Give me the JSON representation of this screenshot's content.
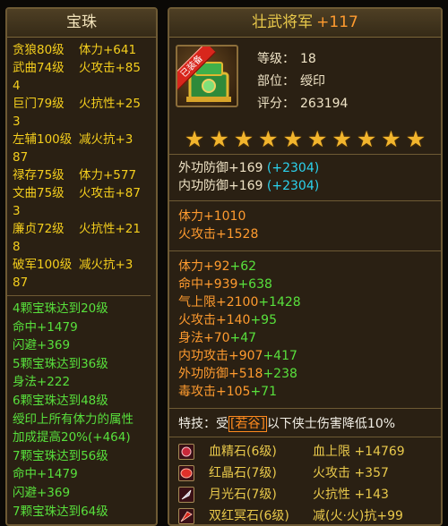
{
  "left_panel": {
    "title": "宝珠",
    "gems": [
      {
        "name": "贪狼80级",
        "stat": "体力+641"
      },
      {
        "name": "武曲74级",
        "stat": "火攻击+85"
      },
      {
        "name": "4",
        "stat": ""
      },
      {
        "name": "巨门79级",
        "stat": "火抗性+25"
      },
      {
        "name": "3",
        "stat": ""
      },
      {
        "name": "左辅100级",
        "stat": "减火抗+3"
      },
      {
        "name": "87",
        "stat": ""
      },
      {
        "name": "禄存75级",
        "stat": "体力+577"
      },
      {
        "name": "文曲75级",
        "stat": "火攻击+87"
      },
      {
        "name": "3",
        "stat": ""
      },
      {
        "name": "廉贞72级",
        "stat": "火抗性+21"
      },
      {
        "name": "8",
        "stat": ""
      },
      {
        "name": "破军100级",
        "stat": "减火抗+3"
      },
      {
        "name": "87",
        "stat": ""
      }
    ],
    "set_bonuses": [
      "4颗宝珠达到20级",
      "命中+1479",
      "闪避+369",
      "5颗宝珠达到36级",
      "身法+222",
      "6颗宝珠达到48级",
      "绶印上所有体力的属性",
      "加成提高20%(+464)",
      "7颗宝珠达到56级",
      "命中+1479",
      "闪避+369",
      "7颗宝珠达到64级"
    ]
  },
  "right_panel": {
    "title": "壮武将军",
    "title_plus": "+117",
    "badge": "已装备",
    "info": [
      {
        "label": "等级：",
        "value": "18"
      },
      {
        "label": "部位：",
        "value": "绶印"
      },
      {
        "label": "评分：",
        "value": "263194"
      }
    ],
    "stars": 10,
    "defense": [
      {
        "text": "外功防御+169",
        "bonus": "(+2304)"
      },
      {
        "text": "内功防御+169",
        "bonus": "(+2304)"
      }
    ],
    "base_stats": [
      "体力+1010",
      "火攻击+1528"
    ],
    "refine_stats": [
      {
        "base": "体力+92",
        "extra": "+62"
      },
      {
        "base": "命中+939",
        "extra": "+638"
      },
      {
        "base": "气上限+2100",
        "extra": "+1428"
      },
      {
        "base": "火攻击+140",
        "extra": "+95"
      },
      {
        "base": "身法+70",
        "extra": "+47"
      },
      {
        "base": "内功攻击+907",
        "extra": "+417"
      },
      {
        "base": "外功防御+518",
        "extra": "+238"
      },
      {
        "base": "毒攻击+105",
        "extra": "+71"
      }
    ],
    "skill": {
      "label": "特技：受",
      "tag": "[若谷]",
      "text": "以下侠士伤害降低10%"
    },
    "gem_slots": [
      {
        "name": "血精石(6级)",
        "stat": "血上限 +14769",
        "icon": "blood-gem-icon",
        "color": "#c8283a"
      },
      {
        "name": "红晶石(7级)",
        "stat": "火攻击 +357",
        "icon": "red-crystal-icon",
        "color": "#e0302a"
      },
      {
        "name": "月光石(7级)",
        "stat": "火抗性 +143",
        "icon": "moonstone-icon",
        "color": "#c9c2d6"
      },
      {
        "name": "双红冥石(6级)",
        "stat": "减(火·火)抗+99",
        "icon": "double-red-gem-icon",
        "color": "#d8261c"
      }
    ]
  }
}
